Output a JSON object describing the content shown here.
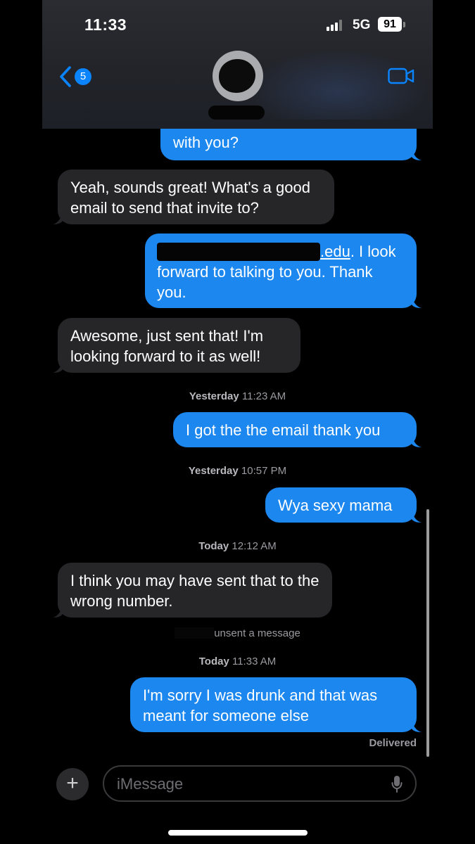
{
  "status_bar": {
    "time": "11:33",
    "network": "5G",
    "battery": "91"
  },
  "header": {
    "back_badge": "5"
  },
  "messages": {
    "m1": "with you?",
    "m2": "Yeah, sounds great! What's a good email to send that invite to?",
    "m3_link": ".edu",
    "m3_rest": ". I look forward to talking to you. Thank you.",
    "m4": "Awesome, just sent that! I'm looking forward to it as well!",
    "ts1_day": "Yesterday",
    "ts1_time": "11:23 AM",
    "m5": "I got the the email thank you",
    "ts2_day": "Yesterday",
    "ts2_time": "10:57 PM",
    "m6": "Wya sexy mama",
    "ts3_day": "Today",
    "ts3_time": "12:12 AM",
    "m7": "I think you may have sent that to the wrong number.",
    "unsent": "unsent a message",
    "ts4_day": "Today",
    "ts4_time": "11:33 AM",
    "m8": "I'm sorry I was drunk and that was meant for someone else",
    "delivered": "Delivered"
  },
  "composer": {
    "placeholder": "iMessage",
    "plus": "+"
  },
  "colors": {
    "outgoing": "#1b87ef",
    "incoming": "#262628",
    "accent": "#0a84ff"
  },
  "icons": [
    "back-chevron-icon",
    "video-camera-icon",
    "plus-icon",
    "microphone-icon"
  ]
}
